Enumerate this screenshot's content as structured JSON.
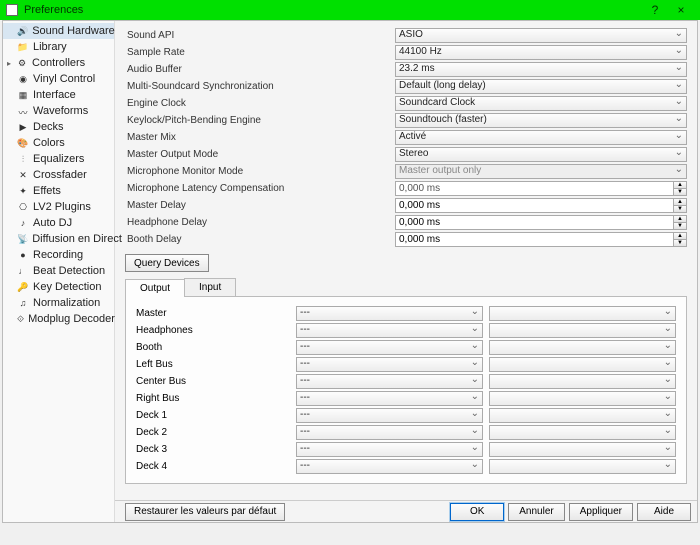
{
  "window": {
    "title": "Preferences",
    "help": "?",
    "close": "×"
  },
  "sidebar": {
    "items": [
      {
        "label": "Sound Hardware",
        "icon": "🔊",
        "selected": true
      },
      {
        "label": "Library",
        "icon": "📁"
      },
      {
        "label": "Controllers",
        "icon": "⚙",
        "expandable": true
      },
      {
        "label": "Vinyl Control",
        "icon": "◉"
      },
      {
        "label": "Interface",
        "icon": "▦"
      },
      {
        "label": "Waveforms",
        "icon": "〰"
      },
      {
        "label": "Decks",
        "icon": "▶"
      },
      {
        "label": "Colors",
        "icon": "🎨"
      },
      {
        "label": "Equalizers",
        "icon": "⫶"
      },
      {
        "label": "Crossfader",
        "icon": "✕"
      },
      {
        "label": "Effets",
        "icon": "✦"
      },
      {
        "label": "LV2 Plugins",
        "icon": "⎔"
      },
      {
        "label": "Auto DJ",
        "icon": "♪"
      },
      {
        "label": "Diffusion en Direct",
        "icon": "📡"
      },
      {
        "label": "Recording",
        "icon": "●"
      },
      {
        "label": "Beat Detection",
        "icon": "♩"
      },
      {
        "label": "Key Detection",
        "icon": "🔑"
      },
      {
        "label": "Normalization",
        "icon": "♫"
      },
      {
        "label": "Modplug Decoder",
        "icon": "⟐"
      }
    ]
  },
  "settings": [
    {
      "label": "Sound API",
      "value": "ASIO",
      "type": "combo"
    },
    {
      "label": "Sample Rate",
      "value": "44100 Hz",
      "type": "combo"
    },
    {
      "label": "Audio Buffer",
      "value": "23.2 ms",
      "type": "combo"
    },
    {
      "label": "Multi-Soundcard Synchronization",
      "value": "Default (long delay)",
      "type": "combo"
    },
    {
      "label": "Engine Clock",
      "value": "Soundcard Clock",
      "type": "combo"
    },
    {
      "label": "Keylock/Pitch-Bending Engine",
      "value": "Soundtouch (faster)",
      "type": "combo"
    },
    {
      "label": "Master Mix",
      "value": "Activé",
      "type": "combo"
    },
    {
      "label": "Master Output Mode",
      "value": "Stereo",
      "type": "combo"
    },
    {
      "label": "Microphone Monitor Mode",
      "value": "Master output only",
      "type": "combo",
      "disabled": true
    },
    {
      "label": "Microphone Latency Compensation",
      "value": "0,000 ms",
      "type": "spin",
      "disabled": true
    },
    {
      "label": "Master Delay",
      "value": "0,000 ms",
      "type": "spin"
    },
    {
      "label": "Headphone Delay",
      "value": "0,000 ms",
      "type": "spin"
    },
    {
      "label": "Booth Delay",
      "value": "0,000 ms",
      "type": "spin"
    }
  ],
  "queryDevices": "Query Devices",
  "tabs": {
    "output": "Output",
    "input": "Input"
  },
  "outputs": [
    {
      "label": "Master",
      "dev": "---",
      "ch": ""
    },
    {
      "label": "Headphones",
      "dev": "---",
      "ch": ""
    },
    {
      "label": "Booth",
      "dev": "---",
      "ch": ""
    },
    {
      "label": "Left Bus",
      "dev": "---",
      "ch": ""
    },
    {
      "label": "Center Bus",
      "dev": "---",
      "ch": ""
    },
    {
      "label": "Right Bus",
      "dev": "---",
      "ch": ""
    },
    {
      "label": "Deck 1",
      "dev": "---",
      "ch": ""
    },
    {
      "label": "Deck 2",
      "dev": "---",
      "ch": ""
    },
    {
      "label": "Deck 3",
      "dev": "---",
      "ch": ""
    },
    {
      "label": "Deck 4",
      "dev": "---",
      "ch": ""
    }
  ],
  "footer": {
    "restore": "Restaurer les valeurs par défaut",
    "ok": "OK",
    "cancel": "Annuler",
    "apply": "Appliquer",
    "help": "Aide"
  }
}
